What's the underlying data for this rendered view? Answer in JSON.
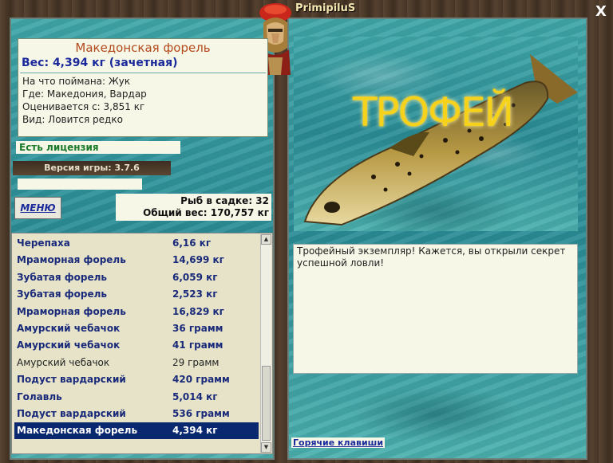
{
  "header": {
    "username": "PrimipiluS",
    "close_label": "X"
  },
  "info_card": {
    "fish_name": "Македонская форель",
    "weight_line": "Вес: 4,394 кг (зачетная)",
    "lines": [
      "На что поймана: Жук",
      "Где: Македония, Вардар",
      "Оценивается с: 3,851 кг",
      "Вид: Ловится редко"
    ]
  },
  "license_text": "Есть лицензия",
  "version_text": "Версия игры: 3.7.6",
  "menu_label": "МЕНЮ",
  "stats": {
    "fish_count": "Рыб в садке: 32",
    "total_weight": "Общий вес: 170,757 кг"
  },
  "catch_list": [
    {
      "name": "Черепаха",
      "weight": "6,16 кг",
      "style": "bold"
    },
    {
      "name": "Мраморная форель",
      "weight": "14,699 кг",
      "style": "bold"
    },
    {
      "name": "Зубатая форель",
      "weight": "6,059 кг",
      "style": "bold"
    },
    {
      "name": "Зубатая форель",
      "weight": "2,523 кг",
      "style": "bold"
    },
    {
      "name": "Мраморная форель",
      "weight": "16,829 кг",
      "style": "bold"
    },
    {
      "name": "Амурский чебачок",
      "weight": "36 грамм",
      "style": "bold"
    },
    {
      "name": "Амурский чебачок",
      "weight": "41 грамм",
      "style": "bold"
    },
    {
      "name": "Амурский чебачок",
      "weight": "29 грамм",
      "style": "plain"
    },
    {
      "name": "Подуст вардарский",
      "weight": "420 грамм",
      "style": "bold"
    },
    {
      "name": "Голавль",
      "weight": "5,014 кг",
      "style": "bold"
    },
    {
      "name": "Подуст вардарский",
      "weight": "536 грамм",
      "style": "bold"
    },
    {
      "name": "Македонская форель",
      "weight": "4,394 кг",
      "style": "selected"
    }
  ],
  "trophy_word": "ТРОФЕЙ",
  "description": "Трофейный экземпляр! Кажется, вы открыли секрет успешной ловли!",
  "hotkeys_label": "Горячие клавиши",
  "icons": {
    "close": "close-icon",
    "scroll_up": "scroll-up-icon",
    "scroll_down": "scroll-down-icon",
    "avatar": "centurion-helmet-icon"
  },
  "colors": {
    "selection": "#0a2870",
    "list_text": "#1a2a7a",
    "trophy": "#f7d21a"
  }
}
